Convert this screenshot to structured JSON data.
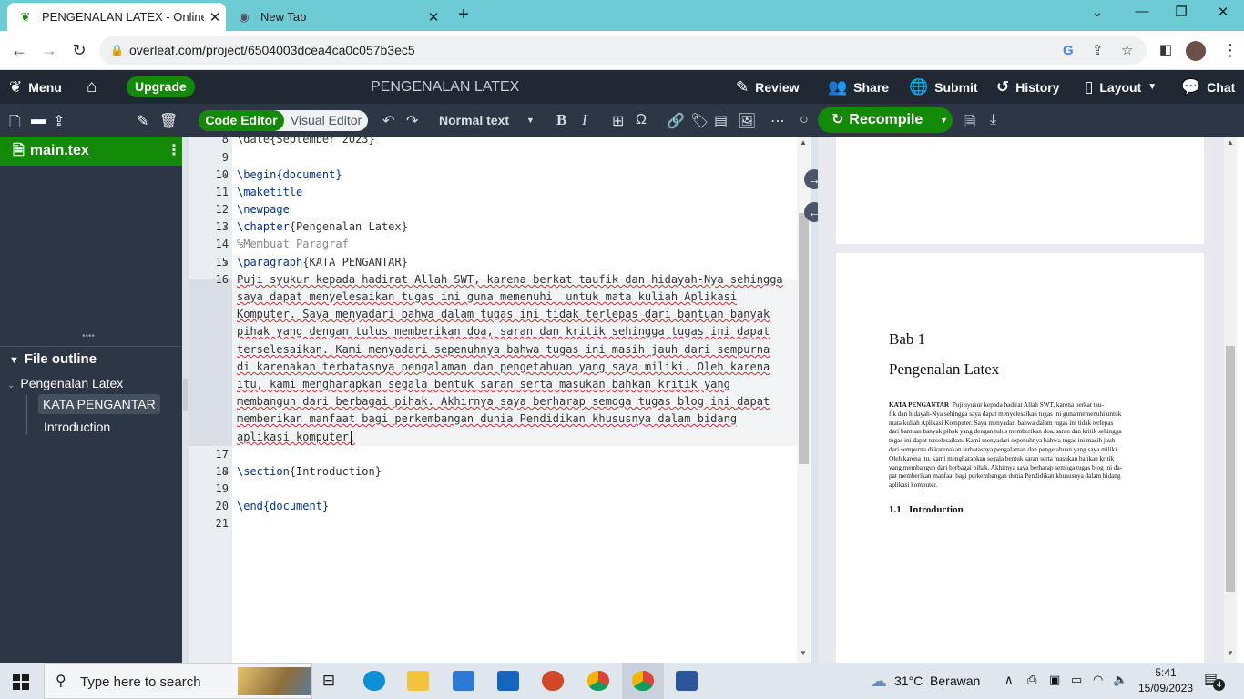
{
  "browser": {
    "tabs": [
      {
        "title": "PENGENALAN LATEX - Online La",
        "active": true
      },
      {
        "title": "New Tab",
        "active": false
      }
    ],
    "new_tab": "+",
    "url": "overleaf.com/project/6504003dcea4ca0c057b3ec5",
    "controls": {
      "minimize": "—",
      "restore": "❐",
      "close": "✕",
      "tab_list": "⌄"
    }
  },
  "header": {
    "menu_label": "Menu",
    "upgrade_label": "Upgrade",
    "project_title": "PENGENALAN LATEX",
    "review_label": "Review",
    "share_label": "Share",
    "submit_label": "Submit",
    "history_label": "History",
    "layout_label": "Layout",
    "chat_label": "Chat"
  },
  "toolbar": {
    "code_editor_label": "Code Editor",
    "visual_editor_label": "Visual Editor",
    "text_style": "Normal text",
    "recompile_label": "Recompile"
  },
  "files": {
    "main_file": "main.tex",
    "outline_title": "File outline",
    "outline": [
      {
        "label": "Pengenalan Latex"
      },
      {
        "label": "KATA PENGANTAR"
      },
      {
        "label": "Introduction"
      }
    ]
  },
  "editor": {
    "line_numbers": [
      "8",
      "9",
      "10",
      "11",
      "12",
      "13",
      "14",
      "15",
      "16",
      "17",
      "18",
      "19",
      "20",
      "21"
    ],
    "lines": {
      "l8": "\\date{September 2023}",
      "l10a": "\\begin",
      "l10b": "{document}",
      "l11": "\\maketitle",
      "l12": "\\newpage",
      "l13a": "\\chapter",
      "l13b": "{Pengenalan Latex}",
      "l14": "%Membuat Paragraf",
      "l15a": "\\paragraph",
      "l15b": "{KATA PENGANTAR}",
      "p1": "Puji syukur kepada hadirat Allah SWT, karena berkat taufik dan hidayah-Nya sehingga",
      "p2": "saya dapat menyelesaikan tugas ini guna memenuhi  untuk mata kuliah Aplikasi",
      "p3": "Komputer. Saya menyadari bahwa dalam tugas ini tidak terlepas dari bantuan banyak",
      "p4": "pihak yang dengan tulus memberikan doa, saran dan kritik sehingga tugas ini dapat",
      "p5": "terselesaikan. Kami menyadari sepenuhnya bahwa tugas ini masih jauh dari sempurna",
      "p6": "di karenakan terbatasnya pengalaman dan pengetahuan yang saya miliki. Oleh karena",
      "p7": "itu, kami mengharapkan segala bentuk saran serta masukan bahkan kritik yang",
      "p8": "membangun dari berbagai pihak. Akhirnya saya berharap semoga tugas blog ini dapat",
      "p9": "memberikan manfaat bagi perkembangan dunia Pendidikan khususnya dalam bidang",
      "p10": "aplikasi komputer.",
      "l18a": "\\section",
      "l18b": "{Introduction}",
      "l20a": "\\end",
      "l20b": "{document}"
    }
  },
  "pdf": {
    "chapter_label": "Bab 1",
    "chapter_title": "Pengenalan Latex",
    "para_head": "KATA PENGANTAR",
    "para_lines": [
      "Puji syukur kepada hadirat Allah SWT, karena berkat tau-",
      "fik dan hidayah-Nya sehingga saya dapat menyelesaikan tugas ini guna memenuhi untuk",
      "mata kuliah Aplikasi Komputer.  Saya menyadari bahwa dalam tugas ini tidak terlepas",
      "dari bantuan banyak pihak yang dengan tulus memberikan doa, saran dan kritik sehingga",
      "tugas ini dapat terselesaikan.  Kami menyadari sepenuhnya bahwa tugas ini masih jauh",
      "dari sempurna di karenakan terbatasnya pengalaman dan pengetahuan yang saya miliki.",
      "Oleh karena itu, kami mengharapkan segala bentuk saran serta masukan bahkan kritik",
      "yang membangun dari berbagai pihak. Akhirnya saya berharap semoga tugas blog ini da-",
      "pat memberikan manfaat bagi perkembangan dunia Pendidikan khususnya dalam bidang",
      "aplikasi komputer."
    ],
    "section_number": "1.1",
    "section_title": "Introduction"
  },
  "taskbar": {
    "search_placeholder": "Type here to search",
    "weather": "31°C  Berawan",
    "time": "5:41",
    "date": "15/09/2023",
    "notification_count": "4"
  }
}
